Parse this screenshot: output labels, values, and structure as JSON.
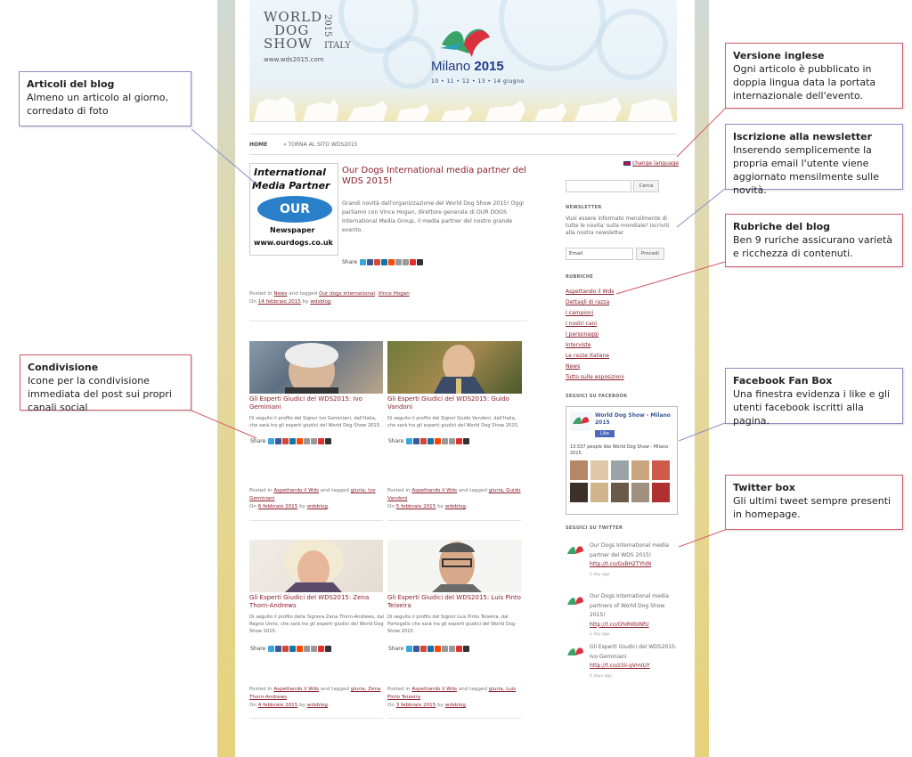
{
  "header": {
    "logo_lines": [
      "WORLD",
      "DOG",
      "SHOW"
    ],
    "logo_year": "2015",
    "logo_country": "ITALY",
    "logo_url": "www.wds2015.com",
    "event_city": "Milano",
    "event_year": "2015",
    "event_dates": "10 • 11 • 12 • 13 • 14 giugno"
  },
  "nav": {
    "home": "HOME",
    "back": "« TORNA AL SITO WDS2015"
  },
  "change_language": "change language",
  "featured": {
    "image_lines": [
      "International",
      "Media Partner",
      "OUR DOGS",
      "Newspaper",
      "www.ourdogs.co.uk"
    ],
    "title": "Our Dogs International media partner del WDS 2015!",
    "body": "Grandi novità dall'organizzazione del World Dog Show 2015! Oggi parliamo con Vince Hogan, direttore generale di OUR DOGS International Media Group, il media partner del nostro grande evento.",
    "share_label": "Share",
    "meta_prefix": "Posted in",
    "category": "News",
    "meta_tagged": "and tagged",
    "tag1": "Our dogs international",
    "tag2": "Vince Hogan",
    "on_label": "On",
    "date": "14 febbraio 2015",
    "by_label": "by",
    "author": "wdsblog"
  },
  "posts": [
    {
      "title": "Gli Esperti Giudici del WDS2015: Ivo Geminiani",
      "excerpt": "Di seguito il profilo del Signor Ivo Geminiani, dall'Italia, che sarà tra gli esperti giudici del World Dog Show 2015.",
      "share_label": "Share",
      "posted_in": "Posted in",
      "category": "Aspettando il Wds",
      "tagged": "and tagged",
      "tags": "giuria, Ivo Geminiani",
      "on_label": "On",
      "date": "6 febbraio 2015",
      "by_label": "by",
      "author": "wdsblog"
    },
    {
      "title": "Gli Esperti Giudici del WDS2015: Guido Vandoni",
      "excerpt": "Di seguito il profilo del Signor Guido Vandoni, dall'Italia, che sarà tra gli esperti giudici del World Dog Show 2015.",
      "share_label": "Share",
      "posted_in": "Posted in",
      "category": "Aspettando il Wds",
      "tagged": "and tagged",
      "tags": "giuria, Guido Vandoni",
      "on_label": "On",
      "date": "5 febbraio 2015",
      "by_label": "by",
      "author": "wdsblog"
    },
    {
      "title": "Gli Esperti Giudici del WDS2015: Zena Thorn-Andrews",
      "excerpt": "Di seguito il profilo della Signora Zena Thorn-Andrews, dal Regno Unito, che sarà tra gli esperti giudici del World Dog Show 2015.",
      "share_label": "Share",
      "posted_in": "Posted in",
      "category": "Aspettando il Wds",
      "tagged": "and tagged",
      "tags": "giuria, Zena Thorn-Andrews",
      "on_label": "On",
      "date": "4 febbraio 2015",
      "by_label": "by",
      "author": "wdsblog"
    },
    {
      "title": "Gli Esperti Giudici del WDS2015: Luis Pinto Teixeira",
      "excerpt": "Di seguito il profilo del Signor Luis Pinto Teixeira, dal Portogallo che sarà tra gli esperti giudici del World Dog Show 2015.",
      "share_label": "Share",
      "posted_in": "Posted in",
      "category": "Aspettando il Wds",
      "tagged": "and tagged",
      "tags": "giuria, Luis Pinto Teixeira",
      "on_label": "On",
      "date": "3 febbraio 2015",
      "by_label": "by",
      "author": "wdsblog"
    }
  ],
  "sidebar": {
    "search_button": "Cerca",
    "newsletter_heading": "NEWSLETTER",
    "newsletter_text": "Vuoi essere informato mensilmente di tutte le novita' sulla mondiale? Iscriviti alla nostra newsletter",
    "email_placeholder": "Email",
    "submit_button": "Procedi",
    "rubriche_heading": "RUBRICHE",
    "rubriche": [
      "Aspettando il Wds",
      "Dettagli di razza",
      "I campioni",
      "I nostri cani",
      "I personaggi",
      "Interviste",
      "Le razze italiane",
      "News",
      "Tutto sulle esposizioni"
    ],
    "facebook_heading": "SEGUICI SU FACEBOOK",
    "fb_page_name": "World Dog Show - Milano 2015",
    "fb_like": "Like",
    "fb_count_text": "13.537 people like World Dog Show - Milano 2015.",
    "twitter_heading": "SEGUICI SU TWITTER",
    "tweets": [
      {
        "text": "Our Dogs International media partner del WDS 2015!",
        "link": "http://t.co/GsBH2TYhlN",
        "time": "1 day ago"
      },
      {
        "text": "Our Dogs International media partners of World Dog Show 2015!",
        "link": "http://t.co/OhIRKbINfU",
        "time": "1 day ago"
      },
      {
        "text": "Gli Esperti Giudici del WDS2015: Ivo Geminiani",
        "link": "http://t.co/z3ii-gVmIUY",
        "time": "4 days ago"
      }
    ]
  },
  "callouts": {
    "articoli": {
      "title": "Articoli del blog",
      "text": "Almeno un articolo al giorno, corredato di foto"
    },
    "condivisione": {
      "title": "Condivisione",
      "text": "Icone per la condivisione immediata del post sui propri canali social"
    },
    "versione": {
      "title": "Versione inglese",
      "text": "Ogni articolo è pubblicato in doppia lingua data la portata internazionale dell'evento."
    },
    "newsletter": {
      "title": "Iscrizione alla newsletter",
      "text": "Inserendo semplicemente la propria email l'utente viene aggiornato mensilmente sulle novità."
    },
    "rubriche": {
      "title": "Rubriche del blog",
      "text": "Ben 9 ruriche assicurano varietà e ricchezza di contenuti."
    },
    "facebook": {
      "title": "Facebook Fan Box",
      "text": "Una finestra evidenza i like e gli utenti facebook iscritti alla pagina."
    },
    "twitter": {
      "title": "Twitter box",
      "text": "Gli ultimi tweet sempre presenti in homepage."
    }
  },
  "colors": {
    "link": "#8a1e2b",
    "callout_blue": "#8a8fc4",
    "callout_red": "#d25a6a",
    "side_band": "#e6d27b"
  }
}
